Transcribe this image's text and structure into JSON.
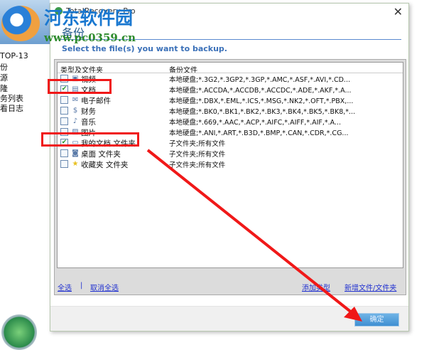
{
  "background": {
    "sidebar_items": [
      "TOP-13",
      "份",
      "源",
      "隆",
      "务列表",
      "看日志"
    ]
  },
  "dialog": {
    "title": "TotalRecovery Pro",
    "header": "备份",
    "subtitle": "Select the file(s) you want to backup.",
    "close_label": "✕",
    "columns": [
      "类型及文件夹",
      "备份文件"
    ],
    "rows": [
      {
        "name": "视频",
        "files": "本地硬盘;*.3G2,*.3GP2,*.3GP,*.AMC,*.ASF,*.AVI,*.CD...",
        "checked": false,
        "icon": "video-icon"
      },
      {
        "name": "文档",
        "files": "本地硬盘;*.ACCDA,*.ACCDB,*.ACCDC,*.ADE,*.AKF,*.A...",
        "checked": true,
        "icon": "document-icon"
      },
      {
        "name": "电子邮件",
        "files": "本地硬盘;*.DBX,*.EML,*.ICS,*.MSG,*.NK2,*.OFT,*.PBX,...",
        "checked": false,
        "icon": "email-icon"
      },
      {
        "name": "财务",
        "files": "本地硬盘;*.BK0,*.BK1,*.BK2,*.BK3,*.BK4,*.BK5,*.BK8,*...",
        "checked": false,
        "icon": "finance-icon"
      },
      {
        "name": "音乐",
        "files": "本地硬盘;*.669,*.AAC,*.ACP,*.AIFC,*.AIFF,*.AIF,*.A...",
        "checked": false,
        "icon": "music-icon"
      },
      {
        "name": "图片",
        "files": "本地硬盘;*.ANI,*.ART,*.B3D,*.BMP,*.CAN,*.CDR,*.CG...",
        "checked": false,
        "icon": "picture-icon"
      },
      {
        "name": "我的文档 文件夹",
        "files": "子文件夹;所有文件",
        "checked": true,
        "icon": "folder-icon"
      },
      {
        "name": "桌面 文件夹",
        "files": "子文件夹;所有文件",
        "checked": false,
        "icon": "desktop-icon"
      },
      {
        "name": "收藏夹 文件夹",
        "files": "子文件夹;所有文件",
        "checked": false,
        "icon": "star-icon"
      }
    ],
    "links": {
      "select_all": "全选",
      "separator": "|",
      "deselect_all": "取消全选",
      "add_type": "添加类型",
      "add_file": "新增文件/文件夹"
    },
    "ok_label": "确定"
  },
  "watermark": {
    "name": "河东软件园",
    "url": "www.pc0359.cn"
  },
  "colors": {
    "accent": "#3f8fd2",
    "annotation": "#f01818"
  }
}
